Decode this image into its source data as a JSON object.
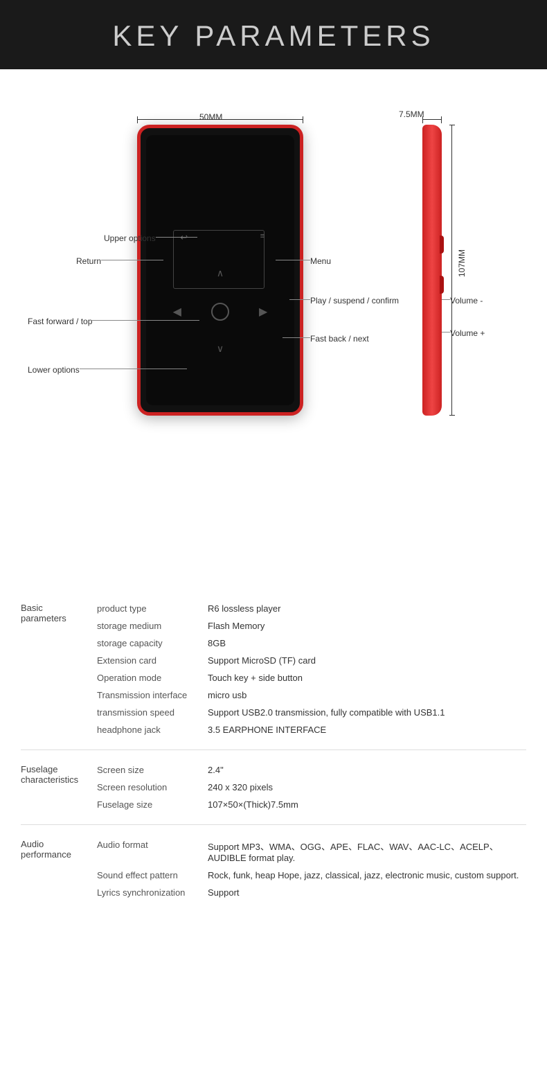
{
  "header": {
    "title": "KEY PARAMETERS"
  },
  "diagram": {
    "dimension_top": "50MM",
    "dimension_side_width": "7.5MM",
    "dimension_height": "107MM",
    "annotations": {
      "upper_options": "Upper options",
      "return": "Return",
      "menu": "Menu",
      "fast_forward": "Fast forward / top",
      "play_suspend": "Play / suspend / confirm",
      "fast_back": "Fast back / next",
      "lower_options": "Lower options",
      "volume_minus": "Volume -",
      "volume_plus": "Volume +"
    }
  },
  "basic_parameters": {
    "group_label": "Basic parameters",
    "rows": [
      {
        "key": "product type",
        "value": "R6 lossless player"
      },
      {
        "key": "storage medium",
        "value": "Flash Memory"
      },
      {
        "key": "storage capacity",
        "value": "8GB"
      },
      {
        "key": "Extension card",
        "value": "Support MicroSD (TF) card"
      },
      {
        "key": "Operation mode",
        "value": "Touch key + side button"
      },
      {
        "key": "Transmission interface",
        "value": "micro usb"
      },
      {
        "key": "transmission speed",
        "value": "Support USB2.0 transmission, fully compatible with USB1.1"
      },
      {
        "key": "headphone jack",
        "value": "3.5 EARPHONE INTERFACE"
      }
    ]
  },
  "fuselage_characteristics": {
    "group_label": "Fuselage characteristics",
    "rows": [
      {
        "key": "Screen size",
        "value": "2.4\""
      },
      {
        "key": "Screen resolution",
        "value": "240 x 320 pixels"
      },
      {
        "key": "Fuselage size",
        "value": "107×50×(Thick)7.5mm"
      }
    ]
  },
  "audio_performance": {
    "group_label": "Audio performance",
    "rows": [
      {
        "key": "Audio format",
        "value": "Support MP3、WMA、OGG、APE、FLAC、WAV、AAC-LC、ACELP、AUDIBLE format play."
      },
      {
        "key": "Sound effect pattern",
        "value": "Rock, funk, heap Hope, jazz, classical, jazz, electronic music, custom support."
      },
      {
        "key": "Lyrics synchronization",
        "value": "Support"
      }
    ]
  }
}
